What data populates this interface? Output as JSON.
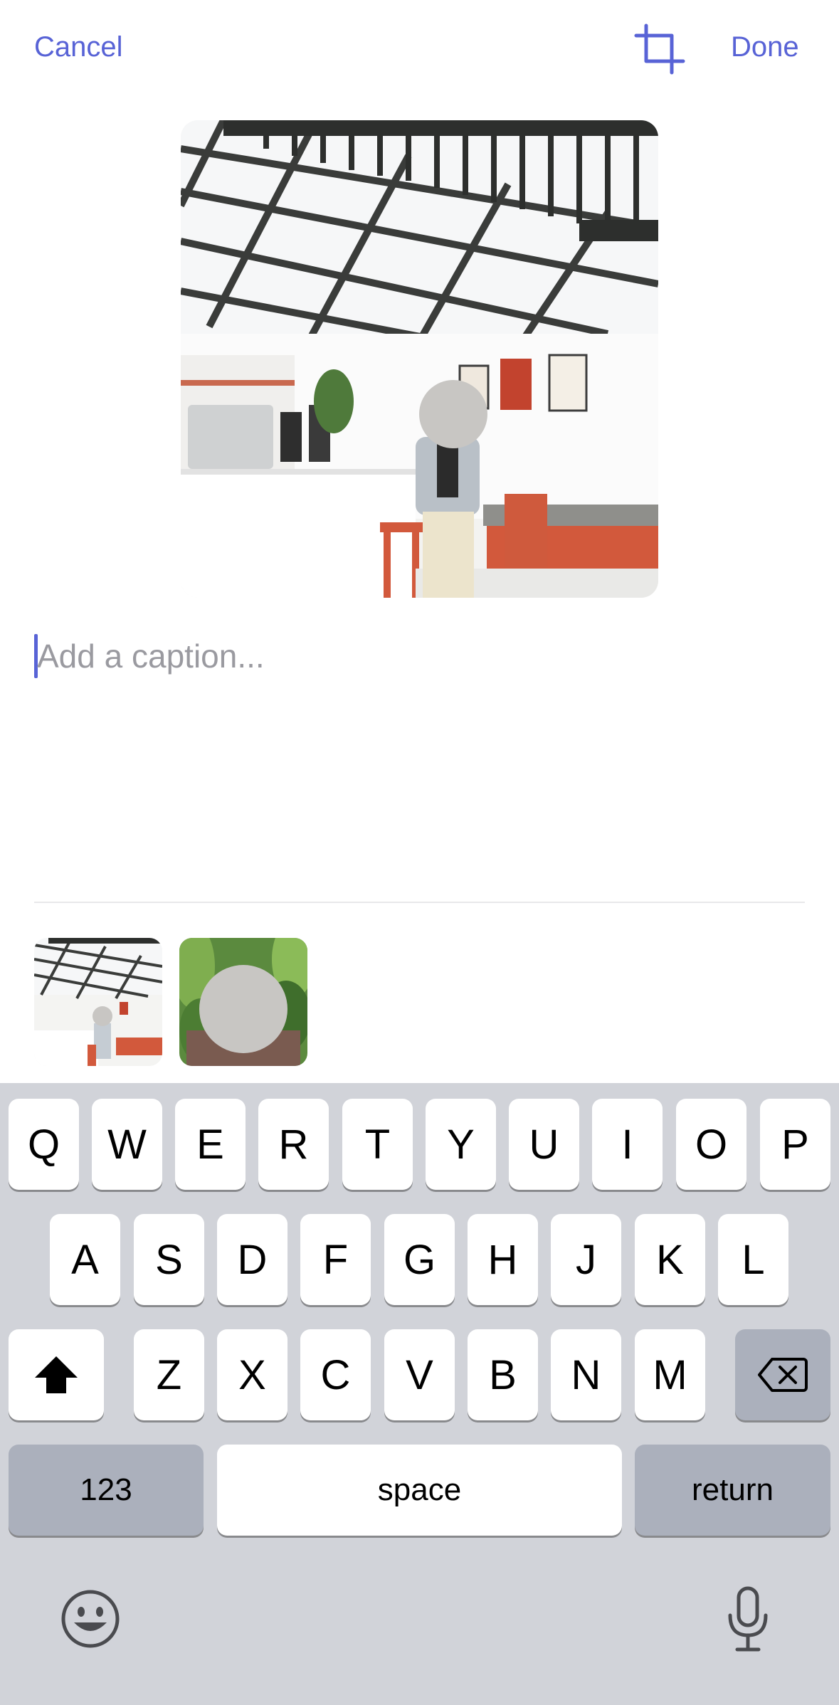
{
  "topbar": {
    "cancel_label": "Cancel",
    "done_label": "Done",
    "crop_icon": "crop-icon"
  },
  "accent_color": "#5863d6",
  "caption": {
    "placeholder": "Add a caption...",
    "value": ""
  },
  "thumbnails": [
    {
      "name": "cafe-interior-thumbnail",
      "selected": true
    },
    {
      "name": "person-plants-thumbnail",
      "selected": false
    }
  ],
  "keyboard": {
    "row1": [
      "Q",
      "W",
      "E",
      "R",
      "T",
      "Y",
      "U",
      "I",
      "O",
      "P"
    ],
    "row2": [
      "A",
      "S",
      "D",
      "F",
      "G",
      "H",
      "J",
      "K",
      "L"
    ],
    "row3": [
      "Z",
      "X",
      "C",
      "V",
      "B",
      "N",
      "M"
    ],
    "numbers_label": "123",
    "space_label": "space",
    "return_label": "return",
    "shift_icon": "shift-icon",
    "delete_icon": "delete-icon",
    "emoji_icon": "emoji-icon",
    "mic_icon": "microphone-icon"
  }
}
